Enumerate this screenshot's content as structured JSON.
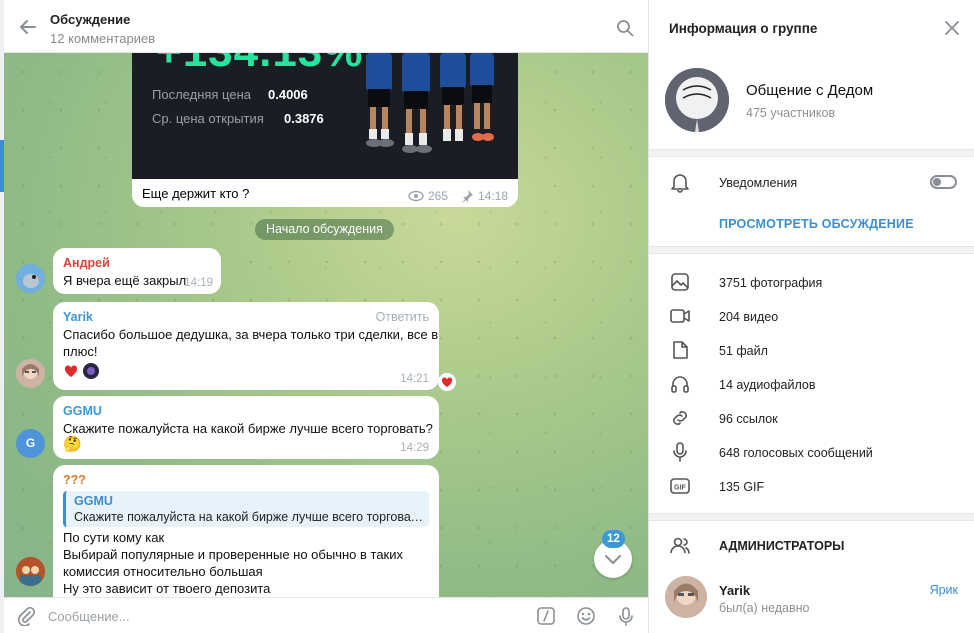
{
  "chat": {
    "title": "Обсуждение",
    "subtitle": "12 комментариев",
    "post": {
      "big_value": "+134.13%",
      "last_price_label": "Последняя цена",
      "last_price_value": "0.4006",
      "open_price_label": "Ср. цена открытия",
      "open_price_value": "0.3876",
      "caption": "Еще держит кто ?",
      "views": "265",
      "time": "14:18"
    },
    "date_pill": "Начало обсуждения",
    "messages": [
      {
        "author": "Андрей",
        "author_color": "#d5473c",
        "text": "Я вчера ещё закрыл",
        "time": "14:19"
      },
      {
        "author": "Yarik",
        "author_color": "#3a98d8",
        "reply_label": "Ответить",
        "text_line1": "Спасибо большое дедушка, за вчера только три сделки, все в",
        "text_line2": "плюс!",
        "time": "14:21"
      },
      {
        "author": "GGMU",
        "author_color": "#3a98d8",
        "text": "Скажите пожалуйста на какой бирже лучше всего торговать?",
        "emoji": "🤔",
        "time": "14:29"
      },
      {
        "author": "???",
        "author_color": "#e07b2a",
        "quote_author": "GGMU",
        "quote_text": "Скажите пожалуйста на какой бирже лучше всего торговать?",
        "lines": [
          "По сути кому как",
          "Выбирай популярные и проверенные но обычно в таких",
          "комиссия относительно большая",
          "Ну это зависит от твоего депозита"
        ]
      }
    ],
    "unread_count": "12",
    "avatar_letter_ggmu": "G",
    "composer_placeholder": "Сообщение..."
  },
  "info": {
    "title": "Информация о группе",
    "group_name": "Общение с Дедом",
    "members": "475 участников",
    "notifications_label": "Уведомления",
    "notifications_on": false,
    "view_discussion": "ПРОСМОТРЕТЬ ОБСУЖДЕНИЕ",
    "media": [
      {
        "icon": "photo-icon",
        "label": "3751 фотография"
      },
      {
        "icon": "video-icon",
        "label": "204 видео"
      },
      {
        "icon": "file-icon",
        "label": "51 файл"
      },
      {
        "icon": "headphones-icon",
        "label": "14 аудиофайлов"
      },
      {
        "icon": "link-icon",
        "label": "96 ссылок"
      },
      {
        "icon": "microphone-icon",
        "label": "648 голосовых сообщений"
      },
      {
        "icon": "gif-icon",
        "label": "135 GIF"
      }
    ],
    "admins_title": "АДМИНИСТРАТОРЫ",
    "admin": {
      "name": "Yarik",
      "status": "был(а) недавно",
      "role": "Ярик"
    }
  },
  "colors": {
    "accent": "#3a8fd4",
    "green_value": "#27e39b"
  }
}
